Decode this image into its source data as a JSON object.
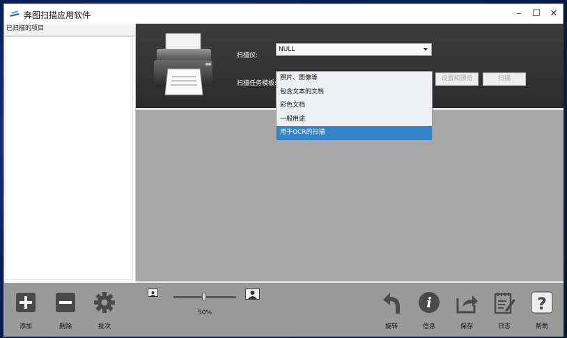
{
  "window": {
    "title": "奔图扫描应用软件",
    "minimize": "–",
    "maximize": "☐",
    "close": "✕"
  },
  "left_panel": {
    "header": "已扫描的项目"
  },
  "scanner": {
    "scanner_label": "扫描仪:",
    "scanner_value": "NULL",
    "template_label": "扫描任务模板:",
    "settings_button": "设置和预览",
    "scan_button": "扫描"
  },
  "dropdown": {
    "items": [
      "照片、图像等",
      "包含文本的文档",
      "彩色文档",
      "一般用途",
      "用于OCR的扫描"
    ],
    "selected_index": 4
  },
  "zoom": {
    "level": "50%",
    "value": 0.5
  },
  "toolbar": {
    "add": "添加",
    "delete": "删除",
    "batch": "批次",
    "rotate": "旋转",
    "info": "信息",
    "save": "保存",
    "log": "日志",
    "help": "帮助"
  },
  "colors": {
    "selected": "#3483cb",
    "top_panel": "#333333",
    "preview": "#a8a8a8",
    "toolbar": "#9a9a9a"
  }
}
